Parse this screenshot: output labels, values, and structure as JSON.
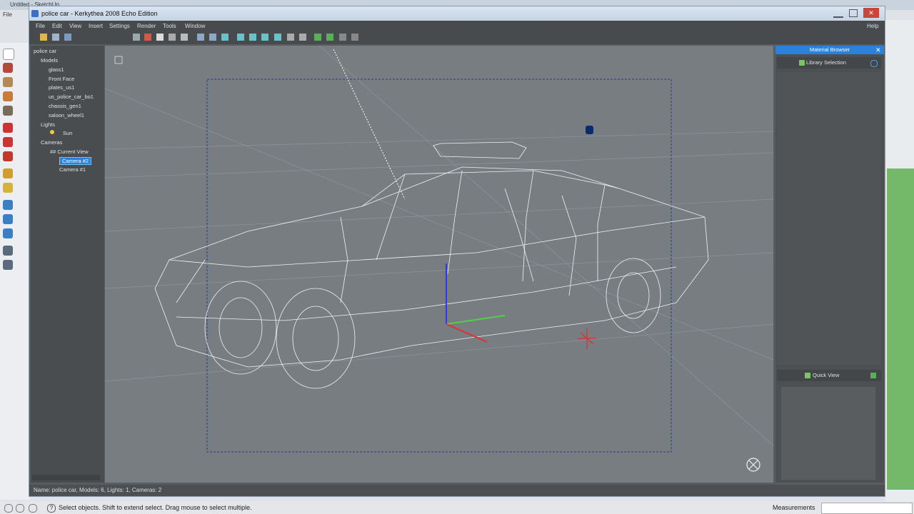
{
  "background_app": {
    "title": "Untitled - SketchUp",
    "menu_file": "File",
    "status_hint": "Select objects. Shift to extend select. Drag mouse to select multiple.",
    "measurements_label": "Measurements"
  },
  "window": {
    "title": "police car - Kerkythea 2008 Echo Edition",
    "menu": [
      "File",
      "Edit",
      "View",
      "Insert",
      "Settings",
      "Render",
      "Tools",
      "Window"
    ],
    "help": "Help"
  },
  "tree": {
    "root": "police car",
    "models_label": "Models",
    "models": [
      "glass1",
      "Front Face",
      "plates_us1",
      "us_police_car_bo1",
      "chassis_gen1",
      "saloon_wheel1"
    ],
    "lights_label": "Lights",
    "lights": [
      "Sun"
    ],
    "cameras_label": "Cameras",
    "cameras": [
      "## Current View",
      "Camera #2",
      "Camera #1"
    ],
    "selected_camera": "Camera #2"
  },
  "material_browser": {
    "title": "Material Browser",
    "library_selection": "Library Selection",
    "quick_view": "Quick View"
  },
  "status": {
    "scene_info": "Name: police car, Models: 6, Lights: 1, Cameras: 2"
  },
  "colors": {
    "accent": "#2a82da",
    "viewport_bg": "#787d82",
    "panel_bg": "#4a4d50"
  }
}
